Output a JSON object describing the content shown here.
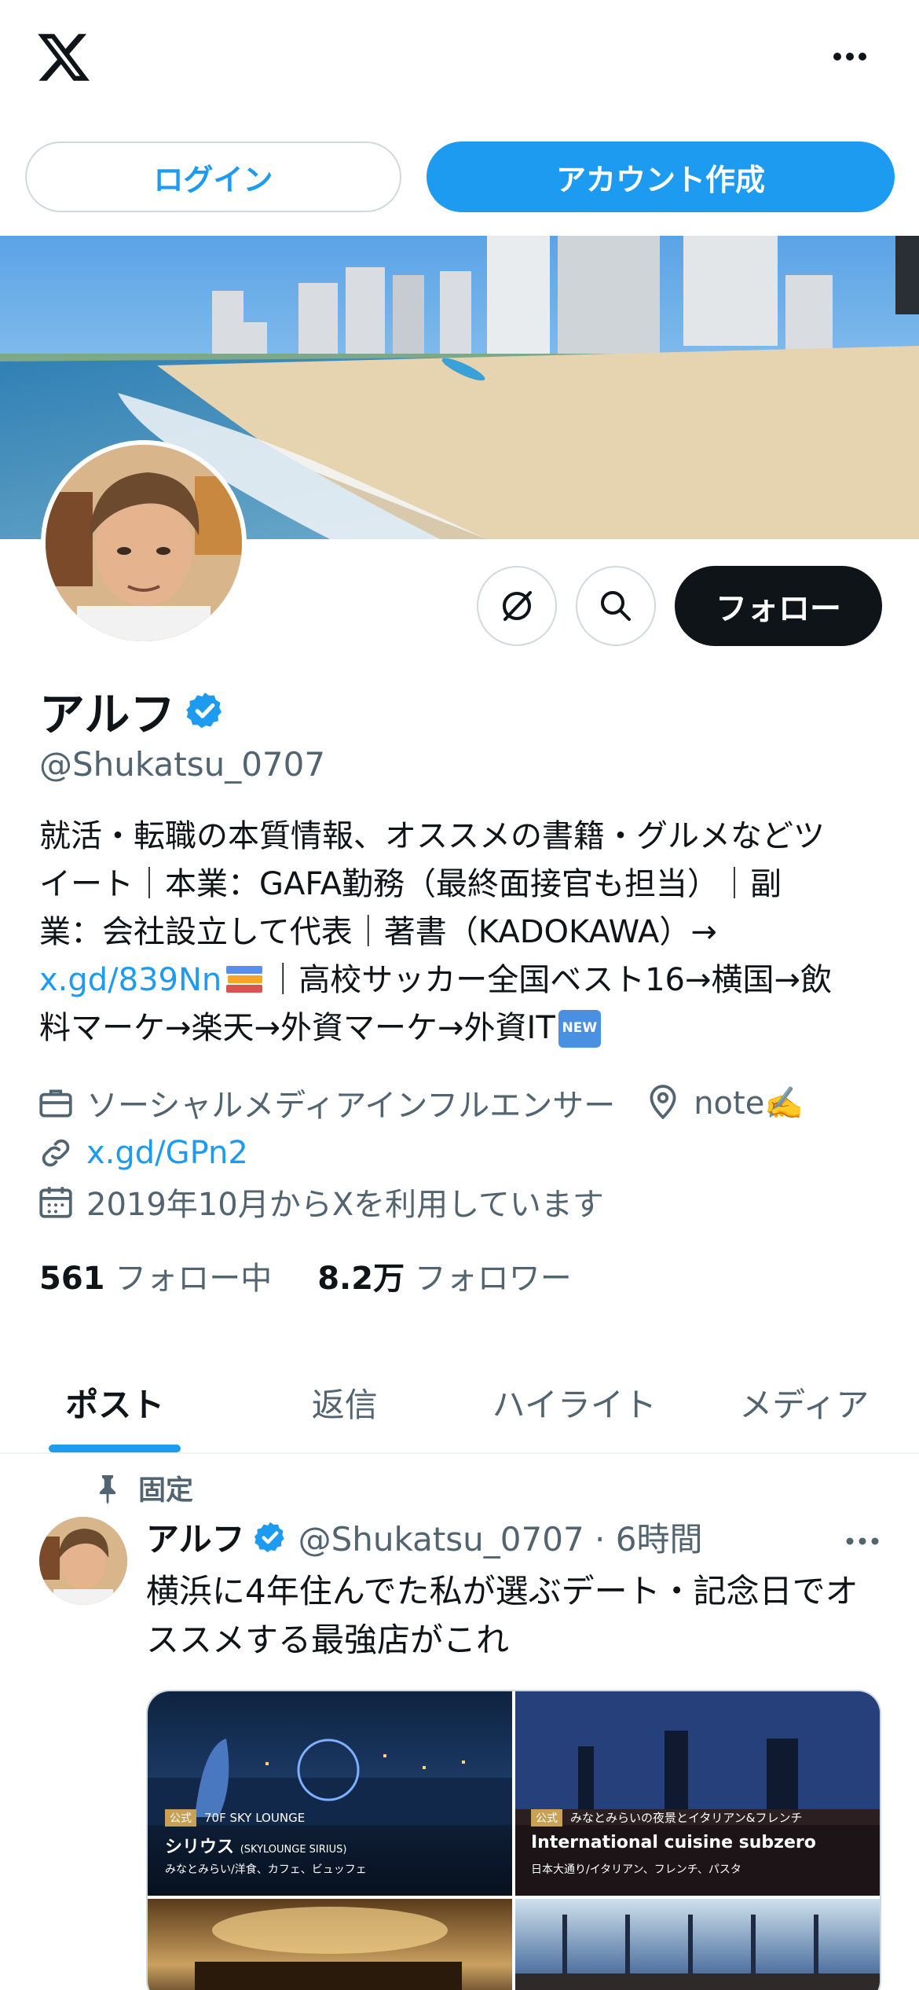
{
  "topbar": {
    "logo_icon": "x-logo-icon",
    "more_icon": "more-horizontal-icon"
  },
  "auth": {
    "login_label": "ログイン",
    "signup_label": "アカウント作成"
  },
  "profile": {
    "name": "アルフ",
    "handle": "@Shukatsu_0707",
    "follow_label": "フォロー",
    "bio": {
      "line1": "就活・転職の本質情報、オススメの書籍・グルメなどツ",
      "line2": "イート｜本業：GAFA勤務（最終面接官も担当）｜副",
      "line3": "業：会社設立して代表｜著書（KADOKAWA）→",
      "link": "x.gd/839Nn",
      "line4_rest": "｜高校サッカー全国ベスト16→横国→飲",
      "line5": "料マーケ→楽天→外資マーケ→外資IT"
    },
    "category": "ソーシャルメディアインフルエンサー",
    "location": "note✍️",
    "website": "x.gd/GPn2",
    "joined": "2019年10月からXを利用しています",
    "following_count": "561",
    "following_label": "フォロー中",
    "followers_count": "8.2万",
    "followers_label": "フォロワー"
  },
  "tabs": [
    {
      "label": "ポスト",
      "active": true
    },
    {
      "label": "返信",
      "active": false
    },
    {
      "label": "ハイライト",
      "active": false
    },
    {
      "label": "メディア",
      "active": false
    }
  ],
  "post": {
    "pinned_label": "固定",
    "author": "アルフ",
    "handle_time": "@Shukatsu_0707 · 6時間",
    "text_line1": "横浜に4年住んでた私が選ぶデート・記念日でオ",
    "text_line2": "ススメする最強店がこれ",
    "media": [
      {
        "badge": "公式",
        "tag": "70F SKY LOUNGE",
        "title": "シリウス",
        "title_small": "(SKYLOUNGE SIRIUS)",
        "sub": "みなとみらい/洋食、カフェ、ビュッフェ"
      },
      {
        "badge": "公式",
        "tag": "みなとみらいの夜景とイタリアン&フレンチ",
        "title": "International cuisine subzero",
        "sub": "日本大通り/イタリアン、フレンチ、パスタ"
      }
    ]
  },
  "colors": {
    "accent": "#1d9bf0",
    "text": "#0f1419",
    "muted": "#536471",
    "border": "#cfd9de"
  }
}
